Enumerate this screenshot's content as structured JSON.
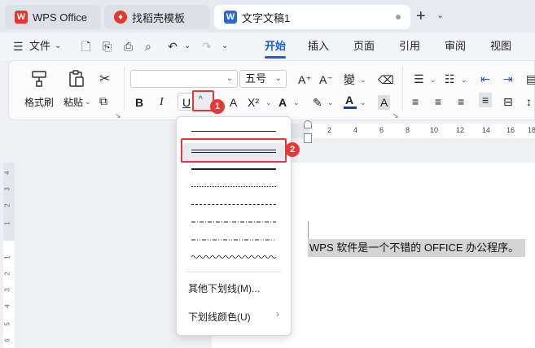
{
  "tabs": {
    "wps": "WPS Office",
    "templates": "找稻壳模板",
    "document": "文字文稿1",
    "new_tab": "+"
  },
  "menu": {
    "file": "文件",
    "start": "开始",
    "insert": "插入",
    "page": "页面",
    "reference": "引用",
    "review": "审阅",
    "view": "视图"
  },
  "ribbon": {
    "format_painter": "格式刷",
    "paste": "粘贴",
    "font_size": "五号",
    "bold": "B",
    "italic": "I",
    "underline": "U",
    "superscript": "X²",
    "shading": "A"
  },
  "badges": {
    "one": "1",
    "two": "2"
  },
  "ruler": {
    "h_ticks": [
      "2",
      "4",
      "6",
      "8",
      "10",
      "12",
      "14",
      "16",
      "18"
    ],
    "v_ticks": [
      "4",
      "3",
      "2",
      "1",
      "",
      "1",
      "2",
      "3",
      "4",
      "5",
      "6"
    ]
  },
  "document_text": "WPS 软件是一个不错的 OFFICE 办公程序。",
  "underline_menu": {
    "more_underlines": "其他下划线(M)...",
    "underline_color": "下划线颜色(U)",
    "submenu_arrow": "›"
  },
  "colors": {
    "accent": "#1a5fd6",
    "highlight_red": "#e53935",
    "wps_red": "#e8362d",
    "doc_blue": "#2b66d9"
  }
}
